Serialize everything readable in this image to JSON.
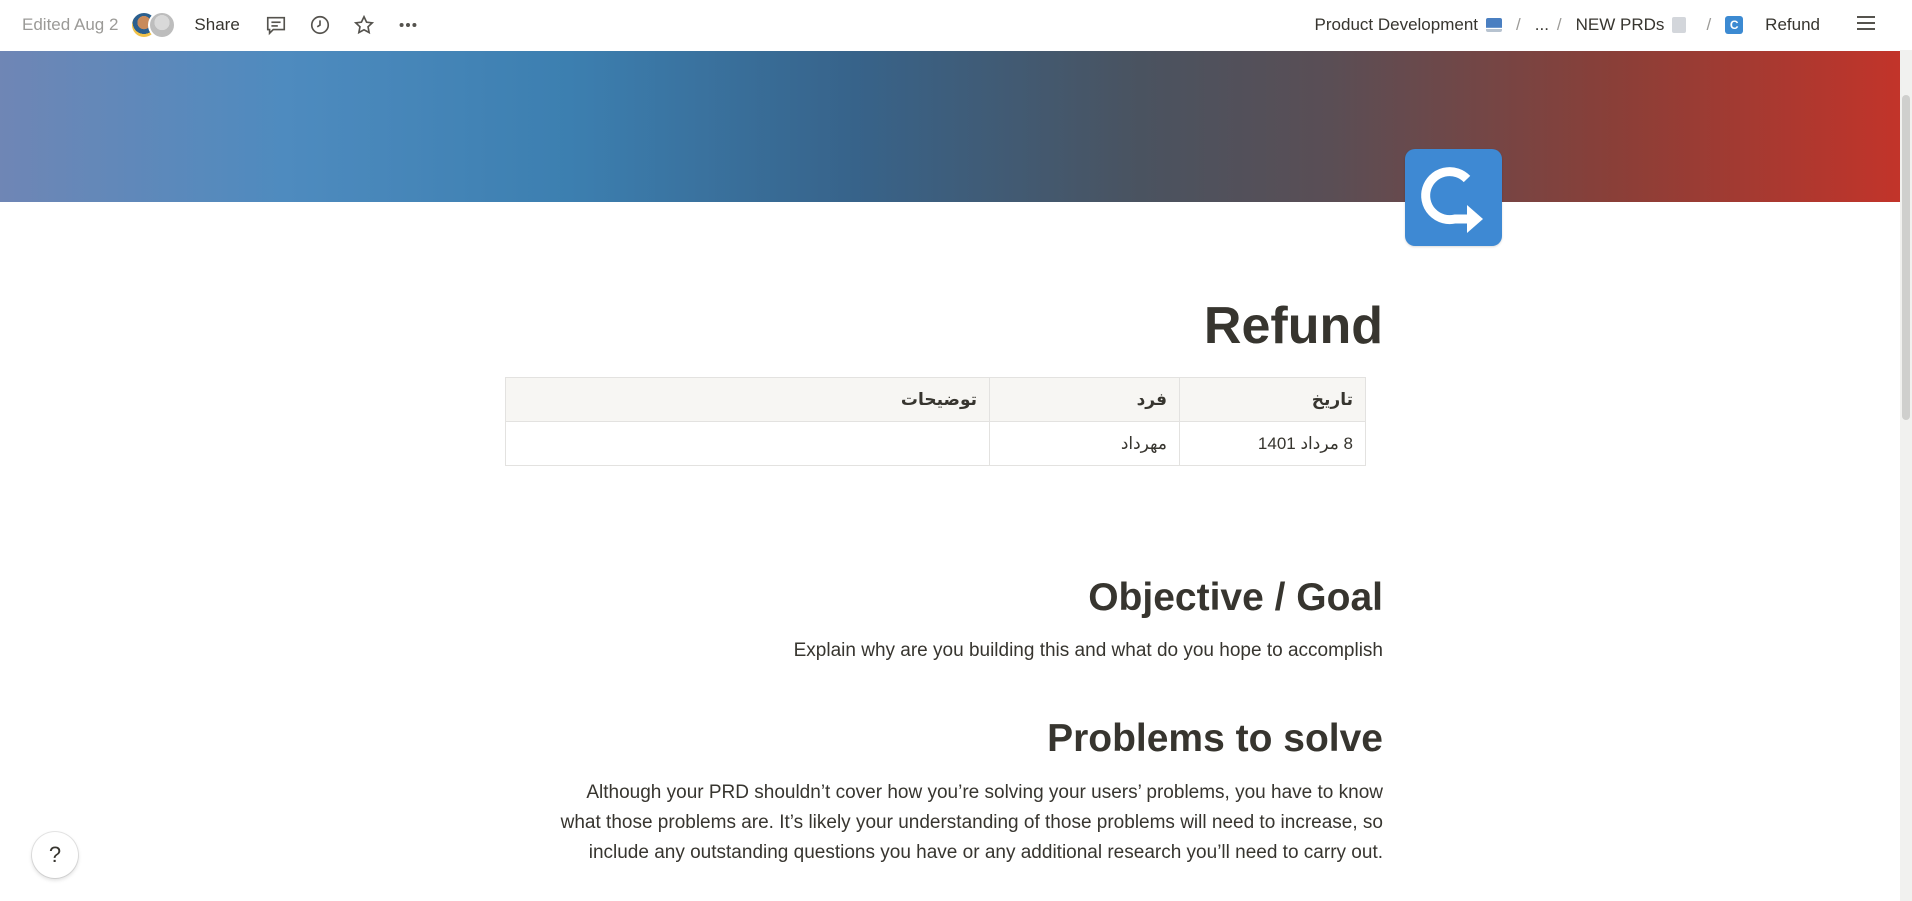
{
  "topbar": {
    "edited_label": "Edited Aug 2",
    "share_label": "Share",
    "icons": [
      "comment-icon",
      "history-icon",
      "star-icon",
      "more-icon"
    ],
    "breadcrumbs": [
      {
        "label": "Product Development",
        "icon": "laptop-icon"
      },
      {
        "label": "..."
      },
      {
        "label": "NEW PRDs",
        "icon": "doc-icon"
      },
      {
        "label": "Refund",
        "icon": "refund-icon"
      }
    ],
    "separator": "/"
  },
  "page": {
    "title": "Refund",
    "icon": "return-arrow-icon",
    "icon_color": "#3e89d3"
  },
  "table": {
    "headers": [
      "تاریخ",
      "فرد",
      "توضیحات"
    ],
    "rows": [
      [
        "8 مرداد 1401",
        "مهرداد",
        ""
      ]
    ]
  },
  "sections": [
    {
      "heading": "Objective / Goal",
      "body": "Explain why are you building this and what do you hope to accomplish"
    },
    {
      "heading": "Problems to solve",
      "body_lines": [
        "Although your PRD shouldn’t cover how you’re solving your users’ problems, you have to know",
        "what those problems are. It’s likely your understanding of those problems will need to increase, so",
        "include any outstanding questions you have or any additional research you’ll need to carry out."
      ]
    }
  ],
  "help_label": "?"
}
